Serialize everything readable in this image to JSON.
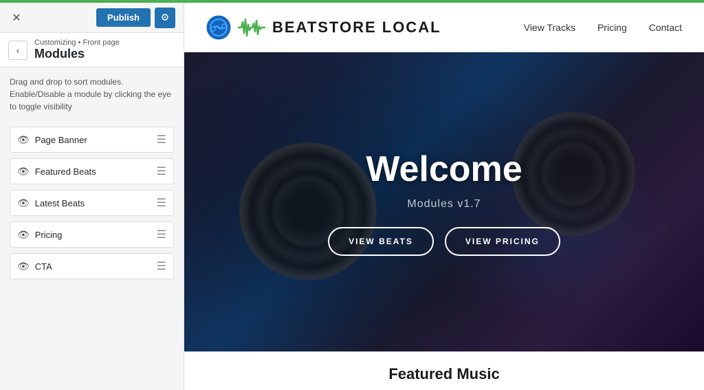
{
  "topbar": {
    "close_icon": "✕",
    "publish_label": "Publish",
    "gear_icon": "⚙"
  },
  "panel": {
    "back_icon": "‹",
    "breadcrumb": "Customizing • Front page",
    "title": "Modules",
    "instructions": "Drag and drop to sort modules. Enable/Disable a module by clicking the eye to toggle visibility",
    "modules": [
      {
        "label": "Page Banner",
        "visible": true
      },
      {
        "label": "Featured Beats",
        "visible": true
      },
      {
        "label": "Latest Beats",
        "visible": true
      },
      {
        "label": "Pricing",
        "visible": true
      },
      {
        "label": "CTA",
        "visible": true
      }
    ]
  },
  "site": {
    "name": "BEATSTORE LOCAL",
    "nav": [
      {
        "label": "View Tracks"
      },
      {
        "label": "Pricing"
      },
      {
        "label": "Contact"
      }
    ]
  },
  "hero": {
    "title": "Welcome",
    "subtitle": "Modules v1.7",
    "btn1": "VIEW BEATS",
    "btn2": "VIEW PRICING"
  },
  "featured": {
    "title": "Featured Music"
  }
}
